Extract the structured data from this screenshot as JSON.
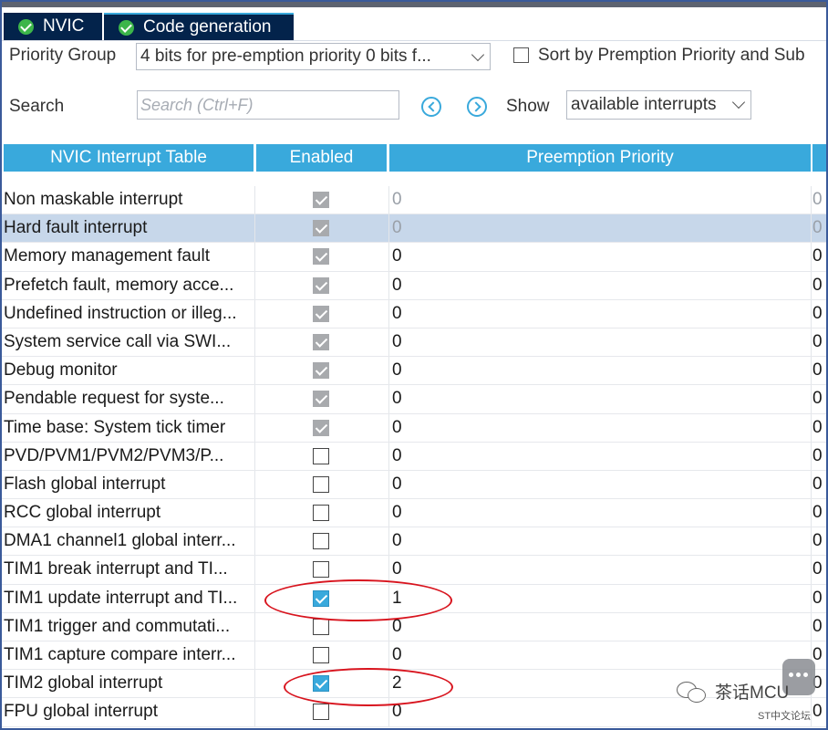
{
  "tabs": [
    {
      "label": "NVIC",
      "icon": "check-circle-icon"
    },
    {
      "label": "Code generation",
      "icon": "check-circle-icon"
    }
  ],
  "controls": {
    "priority_group_label": "Priority Group",
    "priority_group_value": "4 bits for pre-emption priority 0 bits f...",
    "sort_label": "Sort by Premption Priority and Sub",
    "search_label": "Search",
    "search_placeholder": "Search (Ctrl+F)",
    "show_label": "Show",
    "show_value": "available interrupts"
  },
  "table": {
    "headers": [
      "NVIC Interrupt Table",
      "Enabled",
      "Preemption Priority"
    ],
    "rows": [
      {
        "name": "Non maskable interrupt",
        "enabled": "locked",
        "priority": "0",
        "sub": "0",
        "dim": true
      },
      {
        "name": "Hard fault interrupt",
        "enabled": "locked",
        "priority": "0",
        "sub": "0",
        "dim": true,
        "selected": true
      },
      {
        "name": "Memory management fault",
        "enabled": "locked",
        "priority": "0",
        "sub": "0"
      },
      {
        "name": "Prefetch fault, memory acce...",
        "enabled": "locked",
        "priority": "0",
        "sub": "0"
      },
      {
        "name": "Undefined instruction or illeg...",
        "enabled": "locked",
        "priority": "0",
        "sub": "0"
      },
      {
        "name": "System service call via SWI...",
        "enabled": "locked",
        "priority": "0",
        "sub": "0"
      },
      {
        "name": "Debug monitor",
        "enabled": "locked",
        "priority": "0",
        "sub": "0"
      },
      {
        "name": "Pendable request for syste...",
        "enabled": "locked",
        "priority": "0",
        "sub": "0"
      },
      {
        "name": "Time base: System tick timer",
        "enabled": "locked",
        "priority": "0",
        "sub": "0"
      },
      {
        "name": "PVD/PVM1/PVM2/PVM3/P...",
        "enabled": "off",
        "priority": "0",
        "sub": "0"
      },
      {
        "name": "Flash global interrupt",
        "enabled": "off",
        "priority": "0",
        "sub": "0"
      },
      {
        "name": "RCC global interrupt",
        "enabled": "off",
        "priority": "0",
        "sub": "0"
      },
      {
        "name": "DMA1 channel1 global interr...",
        "enabled": "off",
        "priority": "0",
        "sub": "0"
      },
      {
        "name": "TIM1 break interrupt and TI...",
        "enabled": "off",
        "priority": "0",
        "sub": "0"
      },
      {
        "name": "TIM1 update interrupt and TI...",
        "enabled": "on",
        "priority": "1",
        "sub": "0"
      },
      {
        "name": "TIM1 trigger and commutati...",
        "enabled": "off",
        "priority": "0",
        "sub": "0"
      },
      {
        "name": "TIM1 capture compare interr...",
        "enabled": "off",
        "priority": "0",
        "sub": "0"
      },
      {
        "name": "TIM2 global interrupt",
        "enabled": "on",
        "priority": "2",
        "sub": "0"
      },
      {
        "name": "FPU global interrupt",
        "enabled": "off",
        "priority": "0",
        "sub": "0"
      }
    ]
  },
  "watermark": {
    "brand": "茶话MCU",
    "sub": "ST中文论坛"
  },
  "colors": {
    "tab_bg": "#03234b",
    "header_bg": "#39a9dc",
    "check_blue": "#39a9dc",
    "check_gray": "#a8aaad",
    "selected_row": "#c7d7ea",
    "annotation_red": "#d8141e"
  }
}
